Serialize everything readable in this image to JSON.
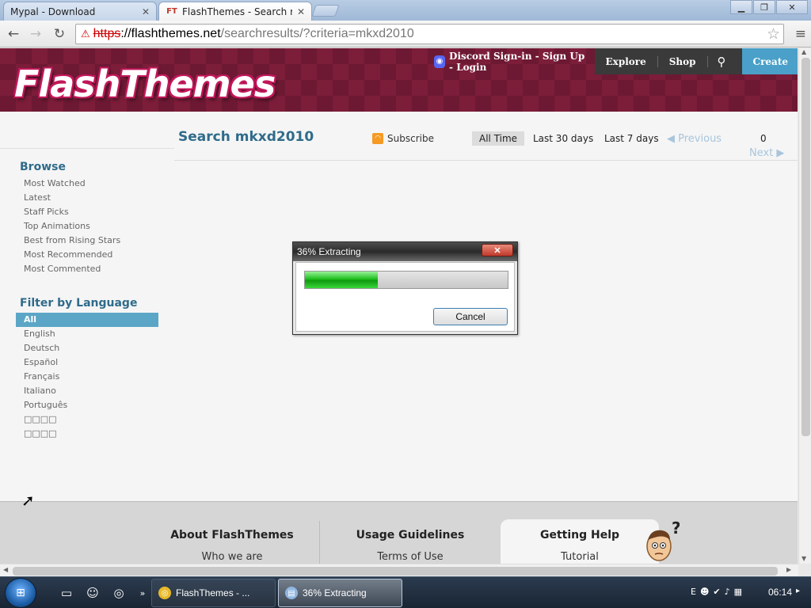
{
  "browser": {
    "tabs": [
      {
        "label": "Mypal - Download",
        "active": false
      },
      {
        "label": "FlashThemes - Search m",
        "active": true
      }
    ],
    "favicon_text": "FT",
    "url": {
      "protocol": "https",
      "host": "://flashthemes.net",
      "path": "/searchresults/?criteria=mkxd2010"
    }
  },
  "header": {
    "logo_text": "FlashThemes",
    "discord_label": "Discord Sign-in - Sign Up - Login",
    "nav": [
      "Explore",
      "Shop"
    ],
    "create_label": "Create"
  },
  "search": {
    "title": "Search mkxd2010",
    "subscribe_label": "Subscribe",
    "time_filters": [
      {
        "label": "All Time",
        "active": true
      },
      {
        "label": "Last 30 days",
        "active": false
      },
      {
        "label": "Last 7 days",
        "active": false
      }
    ],
    "previous_label": "Previous",
    "next_label": "Next",
    "count": "0"
  },
  "sidebar": {
    "browse_title": "Browse",
    "browse_items": [
      "Most Watched",
      "Latest",
      "Staff Picks",
      "Top Animations",
      "Best from Rising Stars",
      "Most Recommended",
      "Most Commented"
    ],
    "language_title": "Filter by Language",
    "language_items": [
      {
        "label": "All",
        "selected": true
      },
      {
        "label": "English",
        "selected": false
      },
      {
        "label": "Deutsch",
        "selected": false
      },
      {
        "label": "Español",
        "selected": false
      },
      {
        "label": "Français",
        "selected": false
      },
      {
        "label": "Italiano",
        "selected": false
      },
      {
        "label": "Português",
        "selected": false
      },
      {
        "label": "□□□□",
        "selected": false
      },
      {
        "label": "□□□□",
        "selected": false
      }
    ]
  },
  "footer": {
    "columns": [
      {
        "title": "About FlashThemes",
        "link": "Who we are"
      },
      {
        "title": "Usage Guidelines",
        "link": "Terms of Use"
      },
      {
        "title": "Getting Help",
        "link": "Tutorial"
      }
    ],
    "mascot_mark": "?"
  },
  "dialog": {
    "title": "36% Extracting",
    "progress_fraction": 0.36,
    "cancel_label": "Cancel"
  },
  "taskbar": {
    "buttons": [
      {
        "label": "FlashThemes - ...",
        "active": false
      },
      {
        "label": "36% Extracting",
        "active": true
      }
    ],
    "tray_lang": "E",
    "clock": "06:14"
  },
  "colors": {
    "header_bg": "#7c1d3a",
    "accent_blue": "#2f6b8a",
    "create_bg": "#4aa0c8",
    "progress_green": "#1fbf1f"
  }
}
